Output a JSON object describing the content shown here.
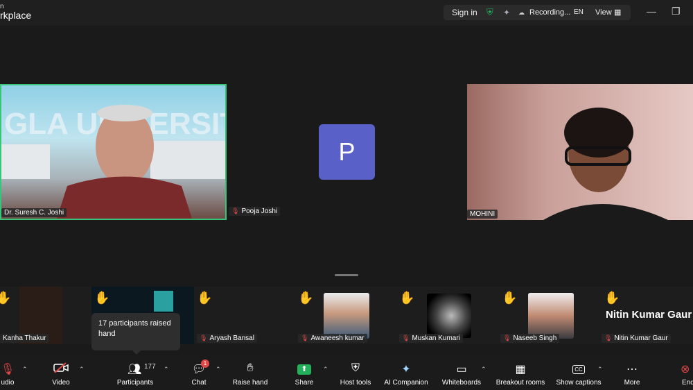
{
  "titlebar": {
    "logo_line1": "n",
    "logo_line2": "rkplace",
    "sign_in": "Sign in",
    "recording": "Recording...",
    "language": "EN",
    "view": "View",
    "minimize": "—",
    "restore": "❐"
  },
  "main_tiles": [
    {
      "name": "Dr. Suresh C. Joshi"
    },
    {
      "name": "Pooja Joshi",
      "avatar_letter": "P"
    },
    {
      "name": "MOHINI"
    }
  ],
  "strip": [
    {
      "name": "Kanha Thakur"
    },
    {
      "name": "Aryash Bansal"
    },
    {
      "name": "Awaneesh kumar"
    },
    {
      "name": "Muskan Kumari"
    },
    {
      "name": "Naseeb Singh"
    },
    {
      "name": "Nitin Kumar Gaur",
      "big_name": "Nitin Kumar Gaur"
    }
  ],
  "tooltip": "17 participants raised hand",
  "toolbar": {
    "audio": "udio",
    "video": "Video",
    "participants": "Participants",
    "participants_count": "177",
    "chat": "Chat",
    "chat_badge": "1",
    "raise_hand": "Raise hand",
    "share": "Share",
    "host_tools": "Host tools",
    "ai_companion": "AI Companion",
    "whiteboards": "Whiteboards",
    "breakout_rooms": "Breakout rooms",
    "show_captions": "Show captions",
    "more": "More",
    "end": "End"
  },
  "colors": {
    "active_speaker_border": "#39c47a",
    "avatar_bg": "#5961c8",
    "share_green": "#22b05a",
    "mic_off_red": "#e04848"
  }
}
